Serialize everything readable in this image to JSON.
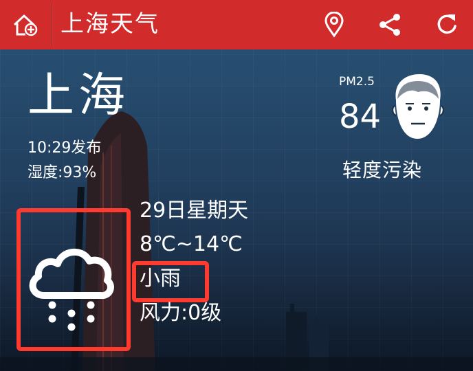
{
  "topbar": {
    "title": "上海天气",
    "bg_color": "#d12b2b",
    "icons": [
      "home-add-icon",
      "location-pin-icon",
      "share-icon",
      "refresh-icon"
    ]
  },
  "current": {
    "city": "上海",
    "publish_time": "10:29发布",
    "humidity": "湿度:93%"
  },
  "air_quality": {
    "label": "PM2.5",
    "value": "84",
    "level": "轻度污染",
    "icon": "face-neutral-icon"
  },
  "forecast": {
    "date": "29日星期天",
    "temperature": "8℃~14℃",
    "condition": "小雨",
    "wind": "风力:0级",
    "icon": "rain-cloud-icon"
  },
  "highlight_color": "#ff3b30"
}
